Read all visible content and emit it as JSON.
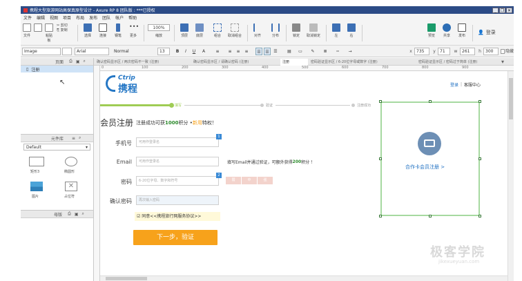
{
  "window": {
    "title": "携程大型旅游网站高保真原型设计 - Axure RP 8 团队版 : ***已授权",
    "buttons": [
      "_",
      "❐",
      "✕"
    ]
  },
  "menu": [
    "文件",
    "编辑",
    "视图",
    "项目",
    "布局",
    "发布",
    "团队",
    "帐户",
    "帮助"
  ],
  "toolbar": {
    "file_label": "文件",
    "clipboard_label": "粘贴板",
    "cut_label": "✂ 剪切",
    "copy_label": "⎘ 复制",
    "paste_label": "☐ 粘贴",
    "select_label": "选择",
    "connect_label": "连接",
    "pen_label": "钢笔",
    "more_label": "更多",
    "zoom_value": "100%",
    "zoom_label": "缩放",
    "top_label": "顶层",
    "bottom_label": "底层",
    "group_label": "组合",
    "ungroup_label": "取消组合",
    "align_label": "对齐",
    "distribute_label": "分布",
    "lock_label": "锁定",
    "unlock_label": "取消锁定",
    "left_label": "左",
    "right_label": "右",
    "preview_label": "预览",
    "share_label": "共享",
    "publish_label": "发布",
    "login_label": "登录"
  },
  "formatbar": {
    "style": "Image",
    "font": "Arial",
    "weight": "Normal",
    "size": "13",
    "x_label": "x",
    "x_value": "735",
    "y_label": "y",
    "y_value": "71",
    "w_label": "w",
    "w_value": "261",
    "h_label": "h",
    "h_value": "300",
    "hidden_label": "隐藏"
  },
  "pages_panel": {
    "title": "页面",
    "items": [
      "注册"
    ]
  },
  "library_panel": {
    "title": "元件库",
    "selected": "Default",
    "items": [
      "矩形3",
      "椭圆形",
      "图片",
      "占位符"
    ]
  },
  "masters_panel": {
    "title": "母版"
  },
  "tabs": [
    "确认密码显示区 / 两次密码不一致 (注册)",
    "确认密码显示区 / 请确认密码 (注册)",
    "注册",
    "密码验证显示区 / 6-20位字母或数字 (注册)",
    "密码验证显示区 / 密码过于简单 (注册)"
  ],
  "ruler_ticks": [
    "0",
    "100",
    "200",
    "300",
    "400",
    "500",
    "600",
    "700",
    "800",
    "900"
  ],
  "canvas": {
    "logo_text": "Ctrip",
    "logo_cn": "携程",
    "top_links": [
      "登录",
      "客服中心"
    ],
    "steps": [
      "填写",
      "验证",
      "注册成功"
    ],
    "heading": "会员注册",
    "subheading_pre": "注册成功可获",
    "subheading_points": "1000",
    "subheading_mid": "积分 • ",
    "subheading_vip": "新用",
    "subheading_post": "特权！",
    "fields": [
      {
        "label": "手机号",
        "placeholder": "可用作登录名"
      },
      {
        "label": "Email",
        "placeholder": "可用作登录名"
      },
      {
        "label": "密码",
        "placeholder": "6-20位字母、数字和符号"
      },
      {
        "label": "确认密码",
        "placeholder": "再次输入密码"
      }
    ],
    "email_hint_pre": "填写Email并通过验证，可额外获得",
    "email_hint_points": "200",
    "email_hint_post": "积分 ！",
    "badge_1": "1",
    "badge_2": "2",
    "strength": [
      "弱",
      "中",
      "强"
    ],
    "agree_text": "☑ 同意<<携程旅行网服务协议>>",
    "next_button": "下一步，验证",
    "partner_text": "合作卡会员注册 >"
  },
  "watermark": {
    "main": "极客学院",
    "sub": "jikexueyuan.com"
  },
  "colors": {
    "titlebar": "#2b4b86",
    "accent_orange": "#f7a21b",
    "ctrip_blue": "#2577c5",
    "step_green": "#9fcc54",
    "link_blue": "#1d6fc2"
  }
}
